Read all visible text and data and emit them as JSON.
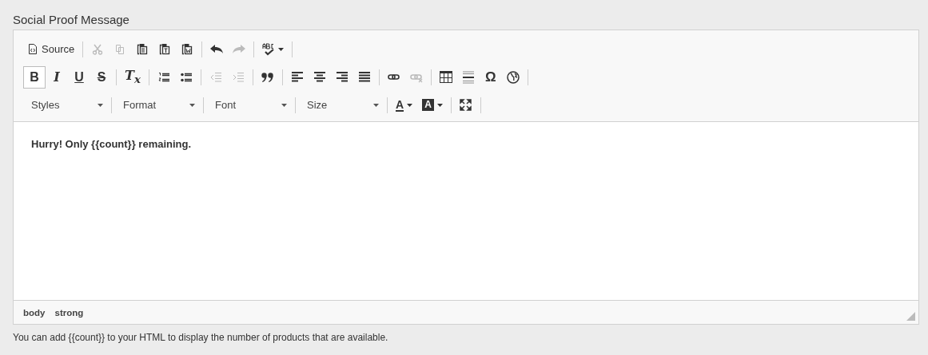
{
  "field": {
    "label": "Social Proof Message",
    "help": "You can add {{count}} to your HTML to display the number of products that are available."
  },
  "toolbar": [
    [
      [
        {
          "kind": "source",
          "label": "Source",
          "disabled": false,
          "active": false
        }
      ],
      [
        {
          "kind": "cut",
          "disabled": true,
          "active": false
        },
        {
          "kind": "copy",
          "disabled": true,
          "active": false
        },
        {
          "kind": "paste",
          "disabled": false,
          "active": false
        },
        {
          "kind": "paste-text",
          "disabled": false,
          "active": false
        },
        {
          "kind": "paste-word",
          "disabled": false,
          "active": false
        }
      ],
      [
        {
          "kind": "undo",
          "disabled": false,
          "active": false
        },
        {
          "kind": "redo",
          "disabled": true,
          "active": false
        }
      ],
      [
        {
          "kind": "spellcheck",
          "disabled": false,
          "active": false
        }
      ]
    ],
    [
      [
        {
          "kind": "bold",
          "label": "B",
          "disabled": false,
          "active": true
        },
        {
          "kind": "italic",
          "label": "I",
          "disabled": false,
          "active": false
        },
        {
          "kind": "underline",
          "label": "U",
          "disabled": false,
          "active": false
        },
        {
          "kind": "strike",
          "label": "S",
          "disabled": false,
          "active": false
        }
      ],
      [
        {
          "kind": "remove-format",
          "label": "T$_{x}$",
          "disabled": false,
          "active": false
        }
      ],
      [
        {
          "kind": "numbered-list",
          "disabled": false,
          "active": false
        },
        {
          "kind": "bulleted-list",
          "disabled": false,
          "active": false
        }
      ],
      [
        {
          "kind": "outdent",
          "disabled": true,
          "active": false
        },
        {
          "kind": "indent",
          "disabled": true,
          "active": false
        }
      ],
      [
        {
          "kind": "blockquote",
          "disabled": false,
          "active": false
        }
      ],
      [
        {
          "kind": "align-left",
          "disabled": false,
          "active": false
        },
        {
          "kind": "align-center",
          "disabled": false,
          "active": false
        },
        {
          "kind": "align-right",
          "disabled": false,
          "active": false
        },
        {
          "kind": "justify",
          "disabled": false,
          "active": false
        }
      ],
      [
        {
          "kind": "link",
          "disabled": false,
          "active": false
        },
        {
          "kind": "unlink",
          "disabled": true,
          "active": false
        }
      ],
      [
        {
          "kind": "table",
          "disabled": false,
          "active": false
        },
        {
          "kind": "horizontal-rule",
          "disabled": false,
          "active": false
        },
        {
          "kind": "special-char",
          "label": "Ω",
          "disabled": false,
          "active": false
        },
        {
          "kind": "globe",
          "disabled": false,
          "active": false
        }
      ]
    ],
    [
      [
        {
          "kind": "combo",
          "label": "Styles"
        }
      ],
      [
        {
          "kind": "combo",
          "label": "Format"
        }
      ],
      [
        {
          "kind": "combo",
          "label": "Font"
        }
      ],
      [
        {
          "kind": "combo",
          "label": "Size"
        }
      ],
      [
        {
          "kind": "text-color",
          "label": "A",
          "disabled": false,
          "active": false
        },
        {
          "kind": "bg-color",
          "label": "A",
          "disabled": false,
          "active": false
        }
      ],
      [
        {
          "kind": "maximize",
          "disabled": false,
          "active": false
        }
      ]
    ]
  ],
  "content": "Hurry! Only {{count}} remaining.",
  "path": [
    "body",
    "strong"
  ]
}
